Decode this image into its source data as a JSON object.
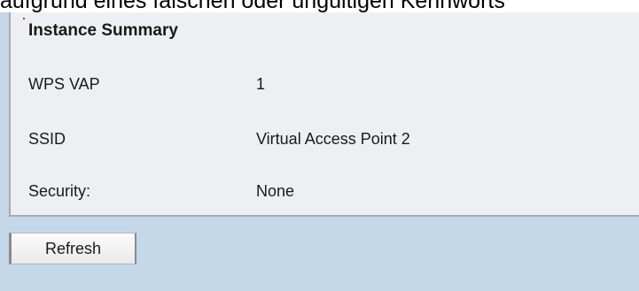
{
  "overlay_text": "aufgrund eines falschen oder ungültigen Kennworts",
  "instance_summary": {
    "title": "Instance Summary",
    "rows": [
      {
        "label": "WPS VAP",
        "value": "1"
      },
      {
        "label": "SSID",
        "value": "Virtual Access Point 2"
      },
      {
        "label": "Security:",
        "value": "None"
      }
    ]
  },
  "actions": {
    "refresh_label": "Refresh"
  },
  "colors": {
    "background": "#c5d8ea",
    "panel": "#eeeff2",
    "panel_border": "#a9a9b0",
    "button_face": "#f2f2f2"
  }
}
